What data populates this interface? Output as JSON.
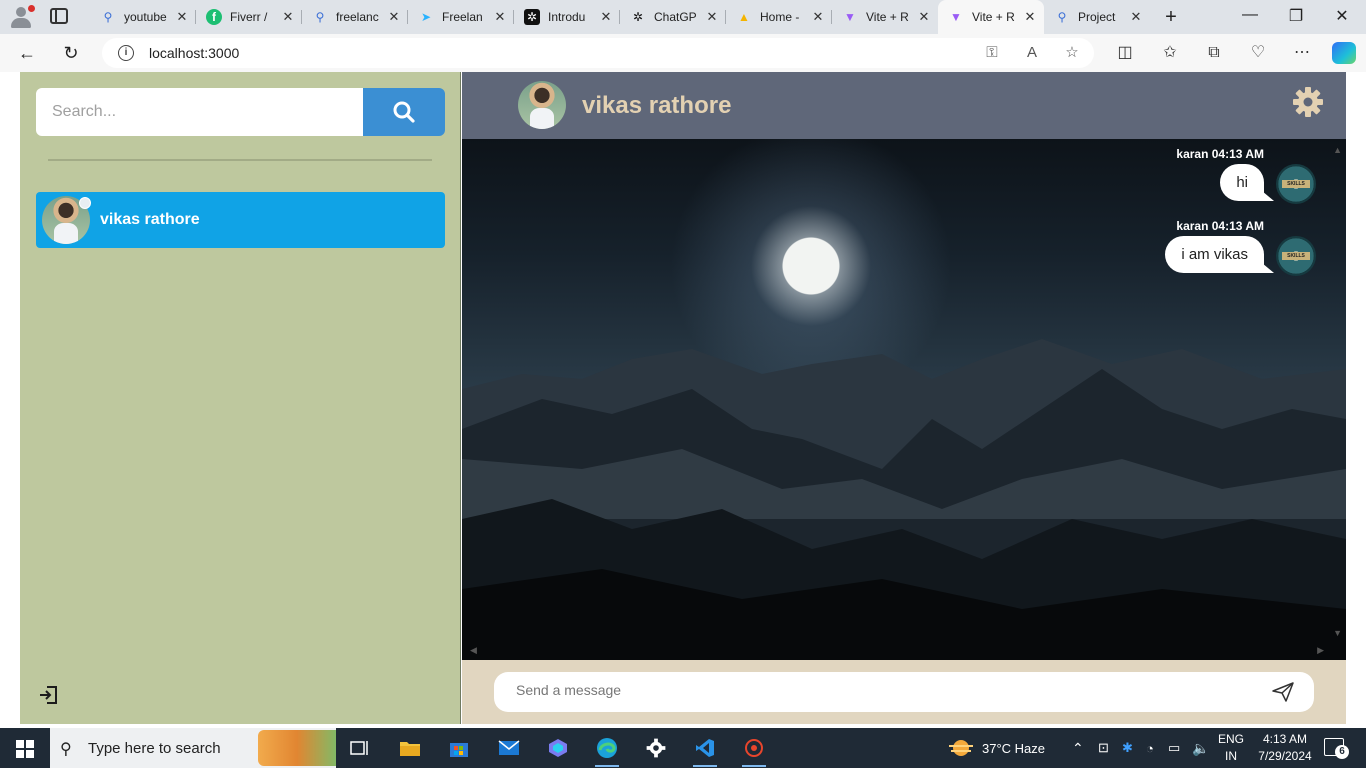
{
  "browser": {
    "tabs": [
      {
        "title": "youtube",
        "icon": "search-icon",
        "color": "#3b6fd6"
      },
      {
        "title": "Fiverr /",
        "icon": "fiverr-icon",
        "color": "#1dbf73"
      },
      {
        "title": "freelanc",
        "icon": "search-icon",
        "color": "#3b6fd6"
      },
      {
        "title": "Freelan",
        "icon": "freelancer-icon",
        "color": "#29b2fe"
      },
      {
        "title": "Introdu",
        "icon": "openai-icon",
        "color": "#111111"
      },
      {
        "title": "ChatGP",
        "icon": "openai-icon",
        "color": "#111111"
      },
      {
        "title": "Home -",
        "icon": "drive-icon",
        "color": "#f4b400"
      },
      {
        "title": "Vite + R",
        "icon": "vite-icon",
        "color": "#9a5cf5"
      },
      {
        "title": "Vite + R",
        "icon": "vite-icon",
        "color": "#9a5cf5"
      },
      {
        "title": "Project",
        "icon": "search-icon",
        "color": "#3b6fd6"
      }
    ],
    "active_tab": 8,
    "url": "localhost:3000"
  },
  "sidebar": {
    "search_placeholder": "Search...",
    "contacts": [
      {
        "name": "vikas rathore"
      }
    ]
  },
  "chat": {
    "header_name": "vikas rathore",
    "messages": [
      {
        "sender": "karan",
        "time": "04:13 AM",
        "meta": "karan 04:13 AM",
        "text": "hi",
        "avatar_label": "SKILLS"
      },
      {
        "sender": "karan",
        "time": "04:13 AM",
        "meta": "karan 04:13 AM",
        "text": "i am vikas",
        "avatar_label": "SKILLS"
      }
    ],
    "composer_placeholder": "Send a message"
  },
  "taskbar": {
    "search_text": "Type here to search",
    "weather": "37°C  Haze",
    "lang_top": "ENG",
    "lang_bottom": "IN",
    "time": "4:13 AM",
    "date": "7/29/2024",
    "notification_count": "6"
  },
  "colors": {
    "sidebar_bg": "#bec89e",
    "contact_active": "#10a3e6",
    "search_button": "#3b8fd3",
    "chat_header_bg": "#5f6779",
    "chat_header_title": "#e3d1b2",
    "composer_bg": "#e1d6c0"
  }
}
